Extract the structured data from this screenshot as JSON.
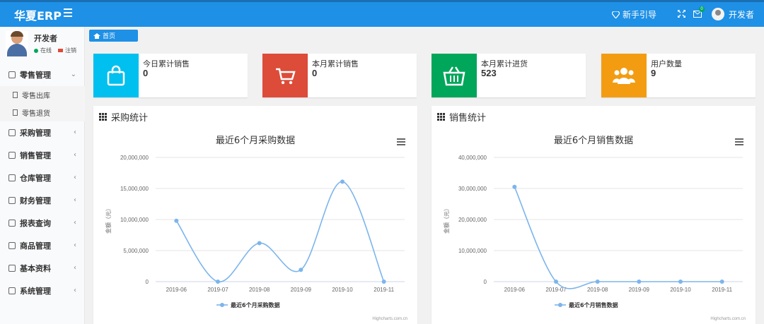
{
  "header": {
    "brand": "华夏ERP",
    "guide_label": "新手引导",
    "mail_badge": "0",
    "user_name": "开发者"
  },
  "sidebar": {
    "user": {
      "name": "开发者",
      "status": "在线",
      "logout": "注销"
    },
    "menu": [
      {
        "label": "零售管理",
        "icon": "shopping-icon",
        "expanded": true,
        "children": [
          {
            "label": "零售出库",
            "icon": "file-icon"
          },
          {
            "label": "零售退货",
            "icon": "file-icon"
          }
        ]
      },
      {
        "label": "采购管理",
        "icon": "monitor-icon"
      },
      {
        "label": "销售管理",
        "icon": "briefcase-icon"
      },
      {
        "label": "仓库管理",
        "icon": "layers-icon"
      },
      {
        "label": "财务管理",
        "icon": "book-icon"
      },
      {
        "label": "报表查询",
        "icon": "pie-icon"
      },
      {
        "label": "商品管理",
        "icon": "cube-icon"
      },
      {
        "label": "基本资料",
        "icon": "apps-icon"
      },
      {
        "label": "系统管理",
        "icon": "gear-icon"
      }
    ]
  },
  "breadcrumb": {
    "home": "首页"
  },
  "stats": [
    {
      "label": "今日累计销售",
      "value": "0",
      "color": "#00c0ef",
      "icon": "shopping-bag-icon"
    },
    {
      "label": "本月累计销售",
      "value": "0",
      "color": "#dd4b39",
      "icon": "shopping-cart-icon"
    },
    {
      "label": "本月累计进货",
      "value": "523",
      "color": "#00a65a",
      "icon": "basket-icon"
    },
    {
      "label": "用户数量",
      "value": "9",
      "color": "#f39c12",
      "icon": "users-icon"
    }
  ],
  "panels": [
    {
      "title": "采购统计"
    },
    {
      "title": "销售统计"
    }
  ],
  "credits": "Highcharts.com.cn",
  "chart_data": [
    {
      "type": "line",
      "title": "最近6个月采购数据",
      "ylabel": "金额（元）",
      "xlabel": "",
      "categories": [
        "2019-06",
        "2019-07",
        "2019-08",
        "2019-09",
        "2019-10",
        "2019-11"
      ],
      "series": [
        {
          "name": "最近6个月采购数据",
          "values": [
            9800000,
            0,
            6200000,
            1900000,
            16100000,
            0
          ]
        }
      ],
      "ylim": [
        0,
        20000000
      ],
      "yticks": [
        "0",
        "5,000,000",
        "10,000,000",
        "15,000,000",
        "20,000,000"
      ],
      "ytick_values": [
        0,
        5000000,
        10000000,
        15000000,
        20000000
      ],
      "color": "#7cb5ec",
      "legend": "bottom"
    },
    {
      "type": "line",
      "title": "最近6个月销售数据",
      "ylabel": "金额（元）",
      "xlabel": "",
      "categories": [
        "2019-06",
        "2019-07",
        "2019-08",
        "2019-09",
        "2019-10",
        "2019-11"
      ],
      "series": [
        {
          "name": "最近6个月销售数据",
          "values": [
            30500000,
            0,
            0,
            0,
            0,
            0
          ]
        }
      ],
      "ylim": [
        0,
        40000000
      ],
      "yticks": [
        "0",
        "10,000,000",
        "20,000,000",
        "30,000,000",
        "40,000,000"
      ],
      "ytick_values": [
        0,
        10000000,
        20000000,
        30000000,
        40000000
      ],
      "color": "#7cb5ec",
      "legend": "bottom"
    }
  ]
}
